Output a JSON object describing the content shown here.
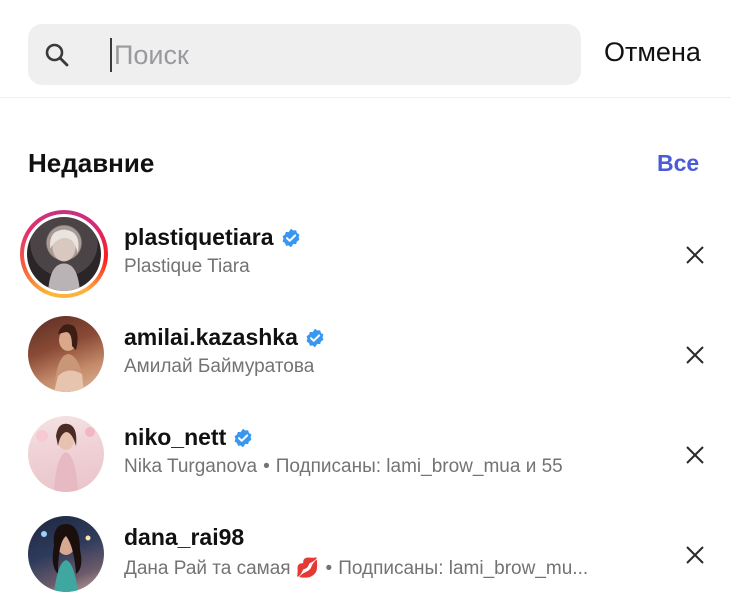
{
  "search": {
    "placeholder": "Поиск",
    "cancel_label": "Отмена"
  },
  "recent": {
    "title": "Недавние",
    "see_all_label": "Все",
    "items": [
      {
        "username": "plastiquetiara",
        "verified": true,
        "name": "Plastique Tiara",
        "extra": "",
        "has_story": true
      },
      {
        "username": "amilai.kazashka",
        "verified": true,
        "name": "Амилай Баймуратова",
        "extra": "",
        "has_story": false
      },
      {
        "username": "niko_nett",
        "verified": true,
        "name": "Nika Turganova",
        "extra": "Подписаны: lami_brow_mua и 55",
        "has_story": false
      },
      {
        "username": "dana_rai98",
        "verified": false,
        "name": "Дана Рай та самая 💋",
        "extra": "Подписаны: lami_brow_mu...",
        "has_story": false
      }
    ]
  },
  "colors": {
    "accent": "#4a5bd8",
    "verified": "#3897f0",
    "secondary_text": "#737373"
  }
}
